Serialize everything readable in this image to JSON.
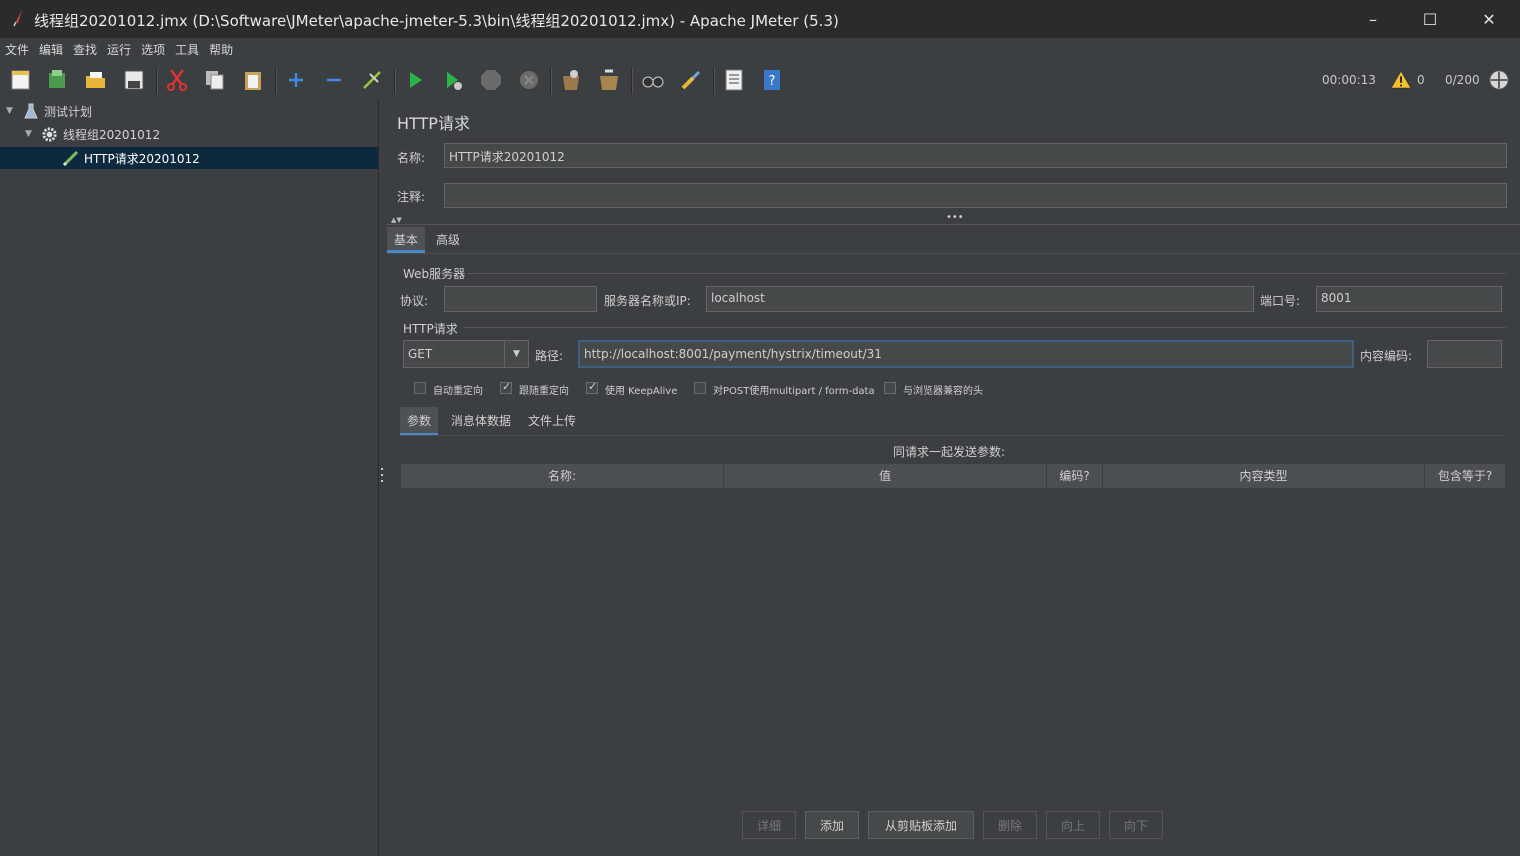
{
  "window": {
    "title": "线程组20201012.jmx (D:\\Software\\JMeter\\apache-jmeter-5.3\\bin\\线程组20201012.jmx) - Apache JMeter (5.3)"
  },
  "menu": [
    "文件",
    "编辑",
    "查找",
    "运行",
    "选项",
    "工具",
    "帮助"
  ],
  "toolbar": {
    "icons": [
      "new-icon",
      "templates-icon",
      "open-icon",
      "save-icon",
      "cut-icon",
      "copy-icon",
      "paste-icon",
      "expand-icon",
      "collapse-icon",
      "toggle-icon",
      "start-icon",
      "start-no-pause-icon",
      "stop-icon",
      "shutdown-icon",
      "clear-icon",
      "clear-all-icon",
      "search-icon",
      "reset-search-icon",
      "function-helper-icon",
      "help-icon"
    ],
    "elapsed": "00:00:13",
    "warnings": "0",
    "threads": "0/200"
  },
  "tree": {
    "items": [
      {
        "label": "测试计划",
        "icon": "flask-icon"
      },
      {
        "label": "线程组20201012",
        "icon": "gear-icon"
      },
      {
        "label": "HTTP请求20201012",
        "icon": "pen-icon"
      }
    ]
  },
  "panel": {
    "heading": "HTTP请求",
    "name_label": "名称:",
    "name_value": "HTTP请求20201012",
    "comment_label": "注释:",
    "comment_value": "",
    "tabs": [
      "基本",
      "高级"
    ],
    "web_server_title": "Web服务器",
    "protocol_label": "协议:",
    "protocol_value": "",
    "server_label": "服务器名称或IP:",
    "server_value": "localhost",
    "port_label": "端口号:",
    "port_value": "8001",
    "http_request_title": "HTTP请求",
    "method_value": "GET",
    "path_label": "路径:",
    "path_value": "http://localhost:8001/payment/hystrix/timeout/31",
    "encoding_label": "内容编码:",
    "encoding_value": "",
    "checkboxes": [
      {
        "label": "自动重定向",
        "checked": false
      },
      {
        "label": "跟随重定向",
        "checked": true
      },
      {
        "label": "使用 KeepAlive",
        "checked": true
      },
      {
        "label": "对POST使用multipart / form-data",
        "checked": false
      },
      {
        "label": "与浏览器兼容的头",
        "checked": false
      }
    ],
    "sub_tabs": [
      "参数",
      "消息体数据",
      "文件上传"
    ],
    "params_caption": "同请求一起发送参数:",
    "columns": [
      "名称:",
      "值",
      "编码?",
      "内容类型",
      "包含等于?"
    ],
    "buttons": {
      "detail": "详细",
      "add": "添加",
      "add_clipboard": "从剪贴板添加",
      "delete": "删除",
      "up": "向上",
      "down": "向下"
    }
  }
}
